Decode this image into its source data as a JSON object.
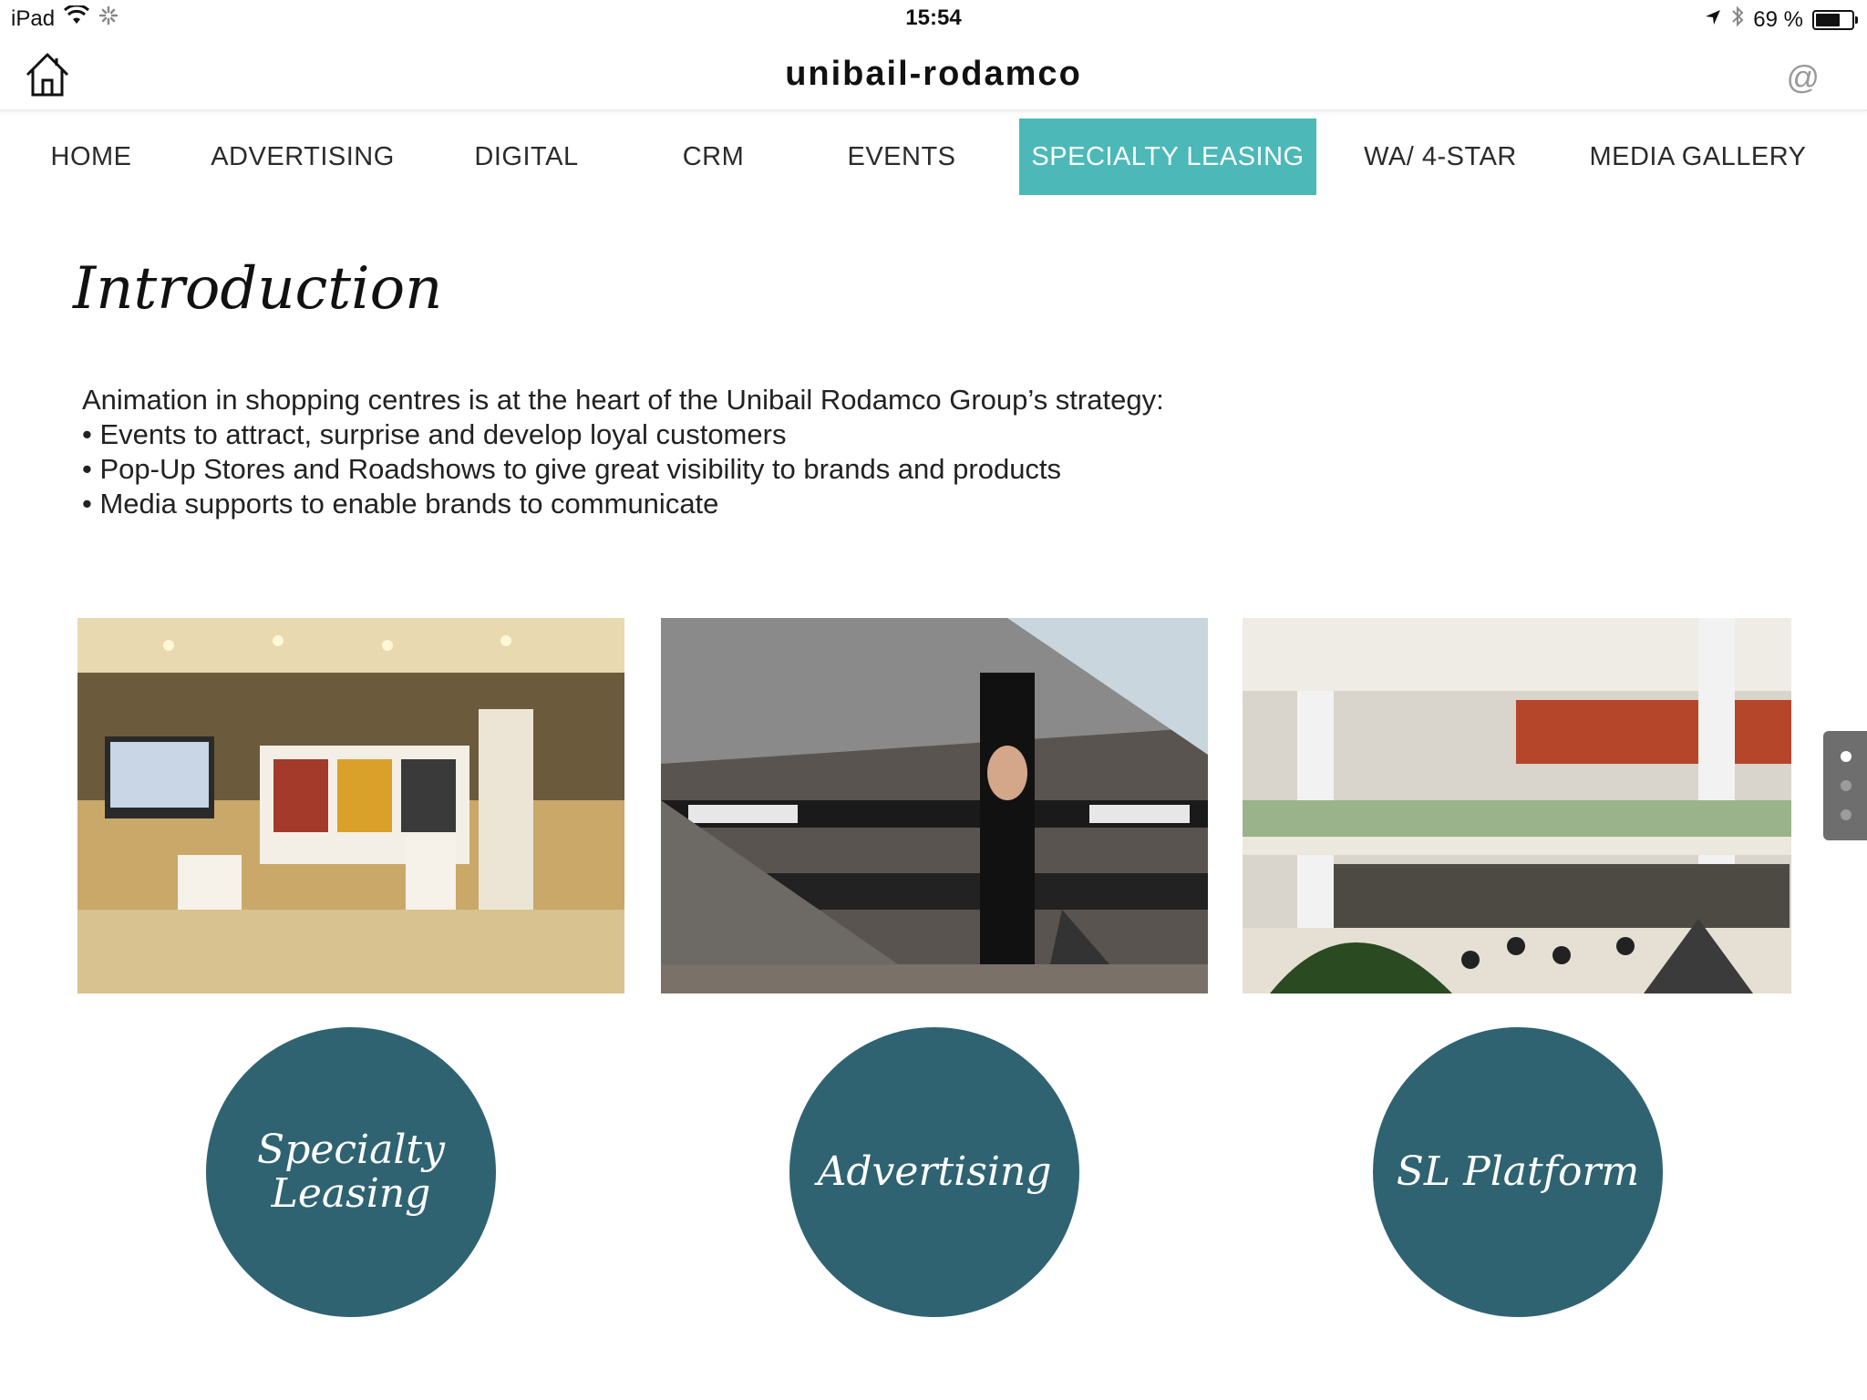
{
  "status_bar": {
    "device": "iPad",
    "time": "15:54",
    "battery": "69 %",
    "battery_level": 0.69
  },
  "header": {
    "title": "unibail-rodamco",
    "at_symbol": "@"
  },
  "nav": {
    "items": [
      {
        "label": "HOME"
      },
      {
        "label": "ADVERTISING"
      },
      {
        "label": "DIGITAL"
      },
      {
        "label": "CRM"
      },
      {
        "label": "EVENTS"
      },
      {
        "label": "SPECIALTY LEASING",
        "active": true
      },
      {
        "label": "WA/ 4-STAR"
      },
      {
        "label": "MEDIA GALLERY"
      }
    ],
    "active_color": "#4cb8b8"
  },
  "intro": {
    "title": "Introduction",
    "lines": [
      "Animation in shopping centres is at the heart of the Unibail Rodamco Group’s strategy:",
      "• Events to attract, surprise and develop loyal customers",
      "• Pop-Up Stores and Roadshows to give great visibility to brands and products",
      "• Media supports to enable brands to communicate"
    ]
  },
  "cards": [
    {
      "label": "Specialty Leasing",
      "label_line1": "Specialty",
      "label_line2": "Leasing"
    },
    {
      "label": "Advertising"
    },
    {
      "label": "SL Platform"
    }
  ],
  "colors": {
    "circle": "#2f6372",
    "accent": "#4cb8b8"
  },
  "pager": {
    "count": 3,
    "active_index": 0
  }
}
